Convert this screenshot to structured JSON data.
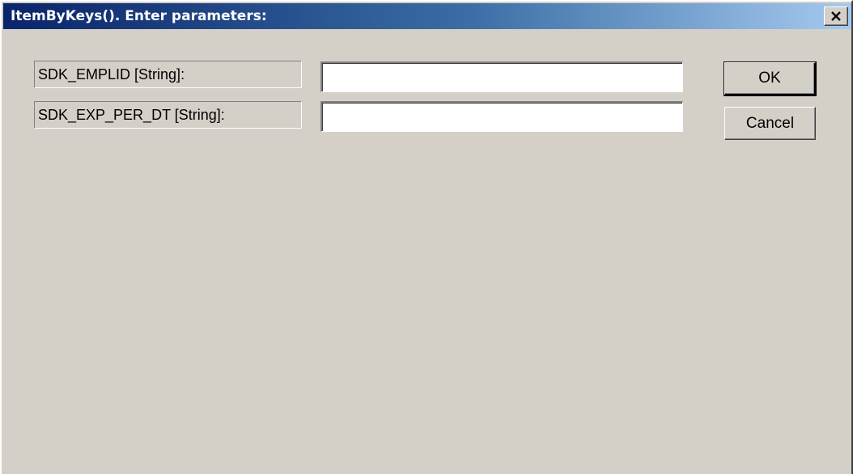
{
  "window": {
    "title": "ItemByKeys(). Enter parameters:",
    "close_icon": "close-icon",
    "colors": {
      "title_gradient_start": "#0a246a",
      "title_gradient_end": "#a6caf0",
      "face": "#d4d0c8"
    }
  },
  "form": {
    "fields": [
      {
        "label": "SDK_EMPLID [String]:",
        "value": "",
        "placeholder": ""
      },
      {
        "label": "SDK_EXP_PER_DT [String]:",
        "value": "",
        "placeholder": ""
      }
    ]
  },
  "buttons": {
    "ok_label": "OK",
    "cancel_label": "Cancel"
  }
}
